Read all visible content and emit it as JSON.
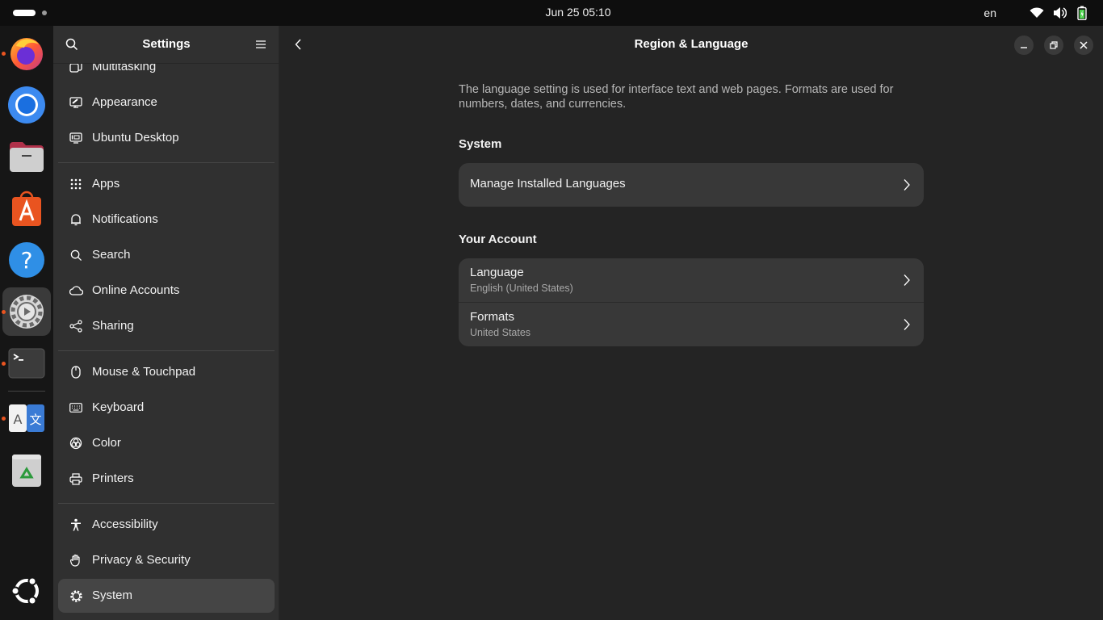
{
  "topbar": {
    "clock": "Jun 25  05:10",
    "lang": "en",
    "icons": [
      "wifi-icon",
      "volume-icon",
      "battery-icon"
    ]
  },
  "dock": {
    "apps": [
      {
        "name": "firefox",
        "running": true
      },
      {
        "name": "chromium",
        "running": false
      },
      {
        "name": "files",
        "running": false
      },
      {
        "name": "app-center",
        "running": false
      },
      {
        "name": "help",
        "running": false
      },
      {
        "name": "settings",
        "running": true,
        "active": true
      },
      {
        "name": "terminal",
        "running": true
      },
      {
        "name": "language-support",
        "running": true
      },
      {
        "name": "trash",
        "running": false
      },
      {
        "name": "show-apps",
        "running": false
      }
    ]
  },
  "sidebar": {
    "title": "Settings",
    "items": [
      {
        "label": "Multitasking",
        "icon": "multitasking-icon"
      },
      {
        "label": "Appearance",
        "icon": "appearance-icon"
      },
      {
        "label": "Ubuntu Desktop",
        "icon": "ubuntu-desktop-icon"
      },
      {
        "label": "Apps",
        "icon": "apps-grid-icon"
      },
      {
        "label": "Notifications",
        "icon": "bell-icon"
      },
      {
        "label": "Search",
        "icon": "search-icon"
      },
      {
        "label": "Online Accounts",
        "icon": "cloud-icon"
      },
      {
        "label": "Sharing",
        "icon": "share-icon"
      },
      {
        "label": "Mouse & Touchpad",
        "icon": "mouse-icon"
      },
      {
        "label": "Keyboard",
        "icon": "keyboard-icon"
      },
      {
        "label": "Color",
        "icon": "color-icon"
      },
      {
        "label": "Printers",
        "icon": "printer-icon"
      },
      {
        "label": "Accessibility",
        "icon": "accessibility-icon"
      },
      {
        "label": "Privacy & Security",
        "icon": "hand-icon"
      },
      {
        "label": "System",
        "icon": "gear-icon",
        "selected": true
      }
    ]
  },
  "main": {
    "title": "Region & Language",
    "description": "The language setting is used for interface text and web pages. Formats are used for numbers, dates, and currencies.",
    "system": {
      "heading": "System",
      "manage_label": "Manage Installed Languages"
    },
    "account": {
      "heading": "Your Account",
      "language_label": "Language",
      "language_value": "English (United States)",
      "formats_label": "Formats",
      "formats_value": "United States"
    }
  },
  "colors": {
    "accent": "#e95420",
    "background": "#242424",
    "sidebar": "#303030",
    "card": "#383838",
    "selected": "#454545"
  }
}
